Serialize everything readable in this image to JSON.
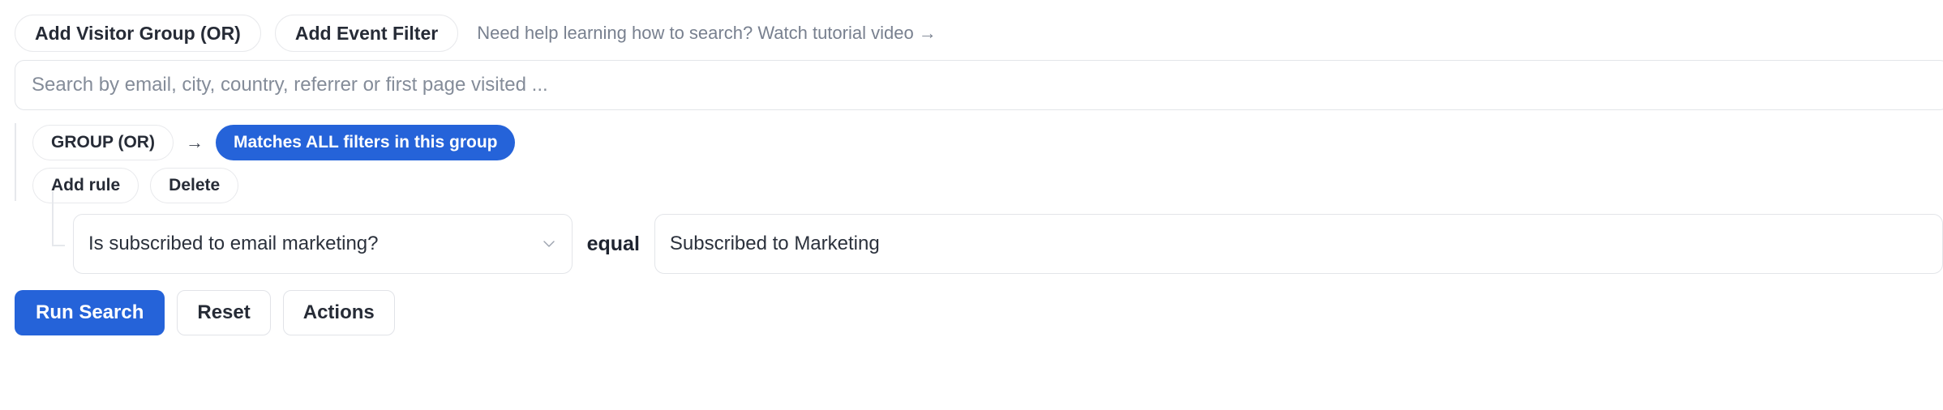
{
  "toolbar": {
    "add_visitor_group_label": "Add Visitor Group (OR)",
    "add_event_filter_label": "Add Event Filter",
    "help_text": "Need help learning how to search? Watch tutorial video →"
  },
  "search": {
    "value": "",
    "placeholder": "Search by email, city, country, referrer or first page visited ..."
  },
  "group": {
    "label": "GROUP (OR)",
    "arrow": "→",
    "match_badge": "Matches ALL filters in this group",
    "add_rule_label": "Add rule",
    "delete_label": "Delete"
  },
  "rule": {
    "field_value": "Is subscribed to email marketing?",
    "operator": "equal",
    "value": "Subscribed to Marketing",
    "value_placeholder": ""
  },
  "footer": {
    "run_search_label": "Run Search",
    "reset_label": "Reset",
    "actions_label": "Actions"
  },
  "colors": {
    "accent": "#2563d9",
    "border": "#e3e5e9",
    "text": "#1f2430",
    "muted": "#78808f"
  }
}
